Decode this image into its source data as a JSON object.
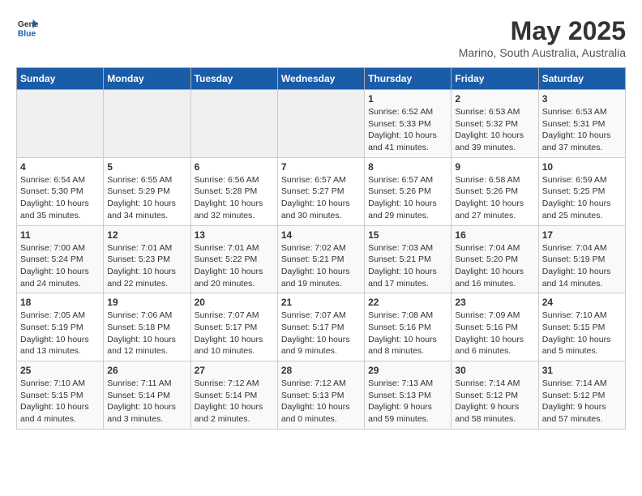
{
  "header": {
    "logo_line1": "General",
    "logo_line2": "Blue",
    "month": "May 2025",
    "location": "Marino, South Australia, Australia"
  },
  "weekdays": [
    "Sunday",
    "Monday",
    "Tuesday",
    "Wednesday",
    "Thursday",
    "Friday",
    "Saturday"
  ],
  "weeks": [
    [
      {
        "num": "",
        "info": ""
      },
      {
        "num": "",
        "info": ""
      },
      {
        "num": "",
        "info": ""
      },
      {
        "num": "",
        "info": ""
      },
      {
        "num": "1",
        "info": "Sunrise: 6:52 AM\nSunset: 5:33 PM\nDaylight: 10 hours and 41 minutes."
      },
      {
        "num": "2",
        "info": "Sunrise: 6:53 AM\nSunset: 5:32 PM\nDaylight: 10 hours and 39 minutes."
      },
      {
        "num": "3",
        "info": "Sunrise: 6:53 AM\nSunset: 5:31 PM\nDaylight: 10 hours and 37 minutes."
      }
    ],
    [
      {
        "num": "4",
        "info": "Sunrise: 6:54 AM\nSunset: 5:30 PM\nDaylight: 10 hours and 35 minutes."
      },
      {
        "num": "5",
        "info": "Sunrise: 6:55 AM\nSunset: 5:29 PM\nDaylight: 10 hours and 34 minutes."
      },
      {
        "num": "6",
        "info": "Sunrise: 6:56 AM\nSunset: 5:28 PM\nDaylight: 10 hours and 32 minutes."
      },
      {
        "num": "7",
        "info": "Sunrise: 6:57 AM\nSunset: 5:27 PM\nDaylight: 10 hours and 30 minutes."
      },
      {
        "num": "8",
        "info": "Sunrise: 6:57 AM\nSunset: 5:26 PM\nDaylight: 10 hours and 29 minutes."
      },
      {
        "num": "9",
        "info": "Sunrise: 6:58 AM\nSunset: 5:26 PM\nDaylight: 10 hours and 27 minutes."
      },
      {
        "num": "10",
        "info": "Sunrise: 6:59 AM\nSunset: 5:25 PM\nDaylight: 10 hours and 25 minutes."
      }
    ],
    [
      {
        "num": "11",
        "info": "Sunrise: 7:00 AM\nSunset: 5:24 PM\nDaylight: 10 hours and 24 minutes."
      },
      {
        "num": "12",
        "info": "Sunrise: 7:01 AM\nSunset: 5:23 PM\nDaylight: 10 hours and 22 minutes."
      },
      {
        "num": "13",
        "info": "Sunrise: 7:01 AM\nSunset: 5:22 PM\nDaylight: 10 hours and 20 minutes."
      },
      {
        "num": "14",
        "info": "Sunrise: 7:02 AM\nSunset: 5:21 PM\nDaylight: 10 hours and 19 minutes."
      },
      {
        "num": "15",
        "info": "Sunrise: 7:03 AM\nSunset: 5:21 PM\nDaylight: 10 hours and 17 minutes."
      },
      {
        "num": "16",
        "info": "Sunrise: 7:04 AM\nSunset: 5:20 PM\nDaylight: 10 hours and 16 minutes."
      },
      {
        "num": "17",
        "info": "Sunrise: 7:04 AM\nSunset: 5:19 PM\nDaylight: 10 hours and 14 minutes."
      }
    ],
    [
      {
        "num": "18",
        "info": "Sunrise: 7:05 AM\nSunset: 5:19 PM\nDaylight: 10 hours and 13 minutes."
      },
      {
        "num": "19",
        "info": "Sunrise: 7:06 AM\nSunset: 5:18 PM\nDaylight: 10 hours and 12 minutes."
      },
      {
        "num": "20",
        "info": "Sunrise: 7:07 AM\nSunset: 5:17 PM\nDaylight: 10 hours and 10 minutes."
      },
      {
        "num": "21",
        "info": "Sunrise: 7:07 AM\nSunset: 5:17 PM\nDaylight: 10 hours and 9 minutes."
      },
      {
        "num": "22",
        "info": "Sunrise: 7:08 AM\nSunset: 5:16 PM\nDaylight: 10 hours and 8 minutes."
      },
      {
        "num": "23",
        "info": "Sunrise: 7:09 AM\nSunset: 5:16 PM\nDaylight: 10 hours and 6 minutes."
      },
      {
        "num": "24",
        "info": "Sunrise: 7:10 AM\nSunset: 5:15 PM\nDaylight: 10 hours and 5 minutes."
      }
    ],
    [
      {
        "num": "25",
        "info": "Sunrise: 7:10 AM\nSunset: 5:15 PM\nDaylight: 10 hours and 4 minutes."
      },
      {
        "num": "26",
        "info": "Sunrise: 7:11 AM\nSunset: 5:14 PM\nDaylight: 10 hours and 3 minutes."
      },
      {
        "num": "27",
        "info": "Sunrise: 7:12 AM\nSunset: 5:14 PM\nDaylight: 10 hours and 2 minutes."
      },
      {
        "num": "28",
        "info": "Sunrise: 7:12 AM\nSunset: 5:13 PM\nDaylight: 10 hours and 0 minutes."
      },
      {
        "num": "29",
        "info": "Sunrise: 7:13 AM\nSunset: 5:13 PM\nDaylight: 9 hours and 59 minutes."
      },
      {
        "num": "30",
        "info": "Sunrise: 7:14 AM\nSunset: 5:12 PM\nDaylight: 9 hours and 58 minutes."
      },
      {
        "num": "31",
        "info": "Sunrise: 7:14 AM\nSunset: 5:12 PM\nDaylight: 9 hours and 57 minutes."
      }
    ]
  ]
}
